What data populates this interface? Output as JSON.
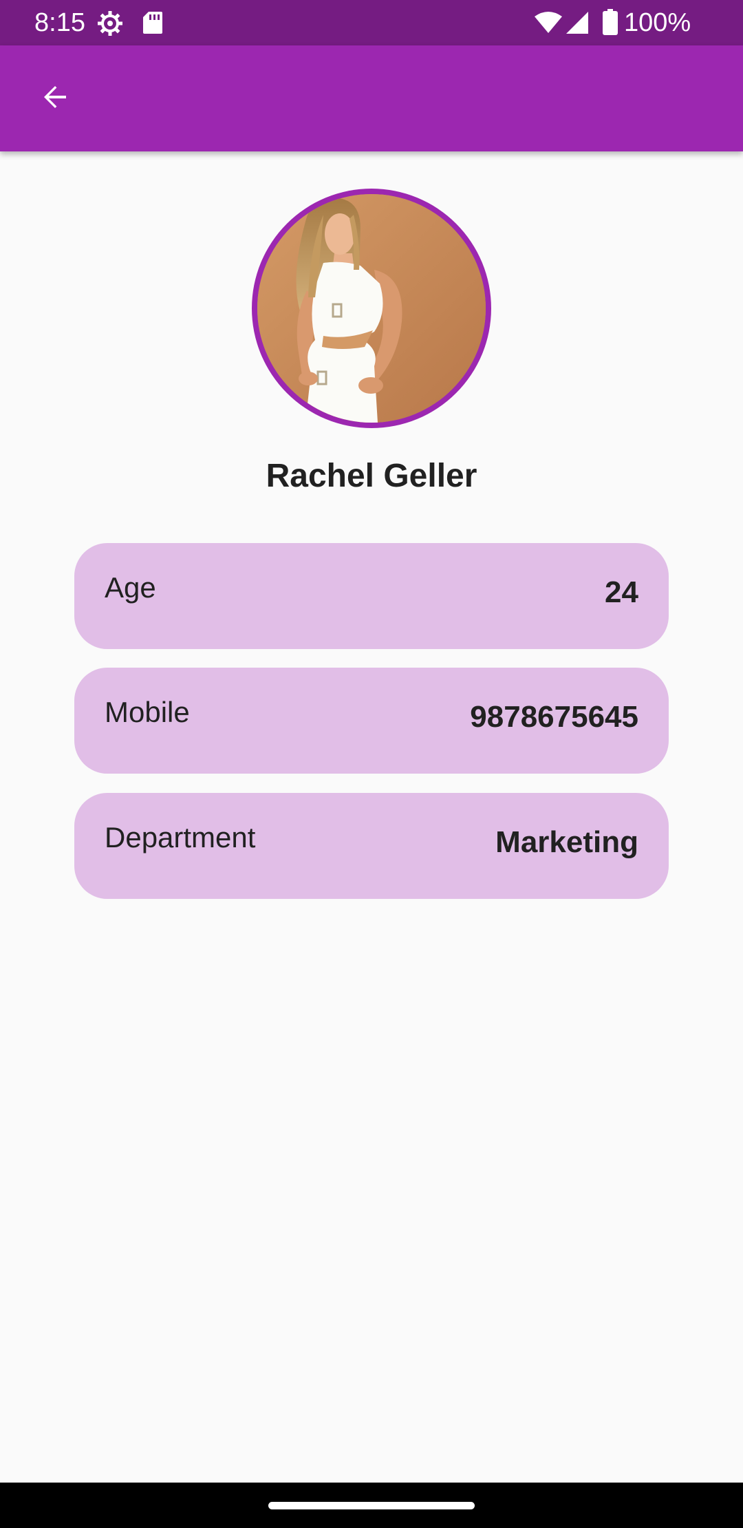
{
  "status_bar": {
    "time": "8:15",
    "battery_percent": "100%",
    "icons": [
      "settings-gear-icon",
      "sd-card-icon",
      "wifi-icon",
      "cell-signal-icon",
      "battery-icon"
    ]
  },
  "app_bar": {
    "back_icon": "arrow-back-icon",
    "background_color": "#9c27b0"
  },
  "profile": {
    "name": "Rachel Geller",
    "avatar": "profile-photo",
    "ring_color": "#9c27b0"
  },
  "details": [
    {
      "label": "Age",
      "value": "24"
    },
    {
      "label": "Mobile",
      "value": "9878675645"
    },
    {
      "label": "Department",
      "value": "Marketing"
    }
  ],
  "colors": {
    "status_bar": "#751c82",
    "card_background": "#e1bee7",
    "page_background": "#fafafa"
  }
}
